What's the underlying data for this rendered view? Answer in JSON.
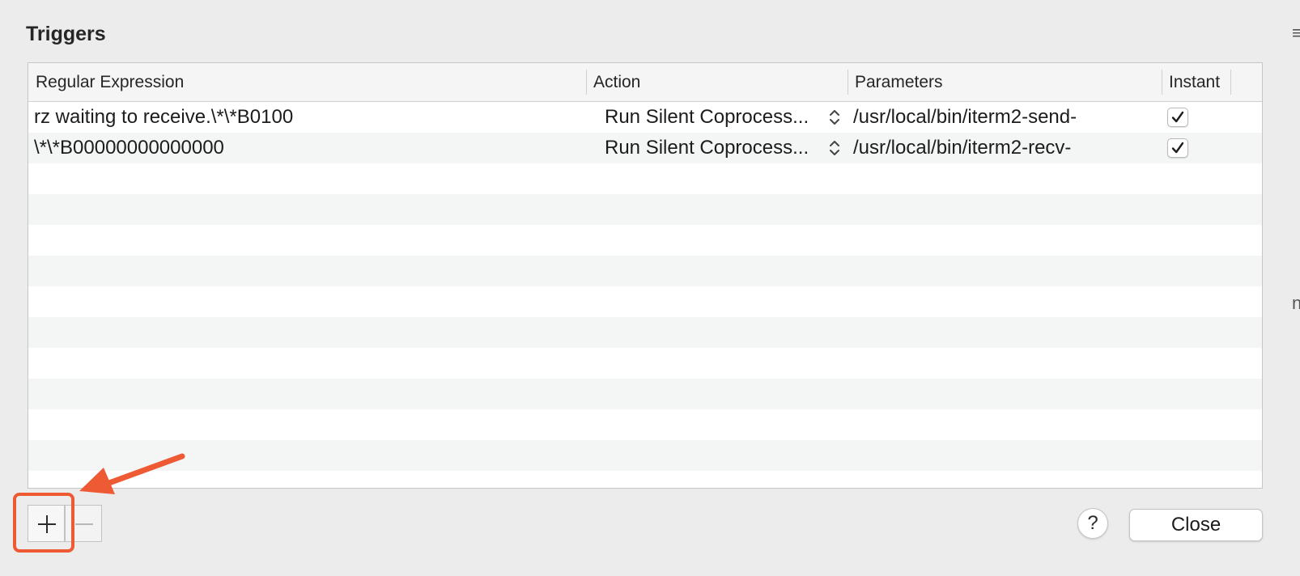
{
  "dialog": {
    "title": "Triggers"
  },
  "table": {
    "columns": [
      {
        "label": "Regular Expression"
      },
      {
        "label": "Action"
      },
      {
        "label": "Parameters"
      },
      {
        "label": "Instant"
      }
    ],
    "rows": [
      {
        "regex": "rz waiting to receive.\\*\\*B0100",
        "action": "Run Silent Coprocess...",
        "parameters": "/usr/local/bin/iterm2-send-",
        "instant": true
      },
      {
        "regex": "\\*\\*B00000000000000",
        "action": "Run Silent Coprocess...",
        "parameters": "/usr/local/bin/iterm2-recv-",
        "instant": true
      }
    ]
  },
  "buttons": {
    "help_label": "?",
    "close_label": "Close"
  },
  "colors": {
    "highlight": "#ee5a33",
    "background": "#ececec",
    "alt_row": "#f4f5f5"
  },
  "icons": {
    "add": "plus-icon",
    "remove": "minus-icon",
    "popup": "updown-chevron-icon",
    "check": "checkmark-icon"
  }
}
